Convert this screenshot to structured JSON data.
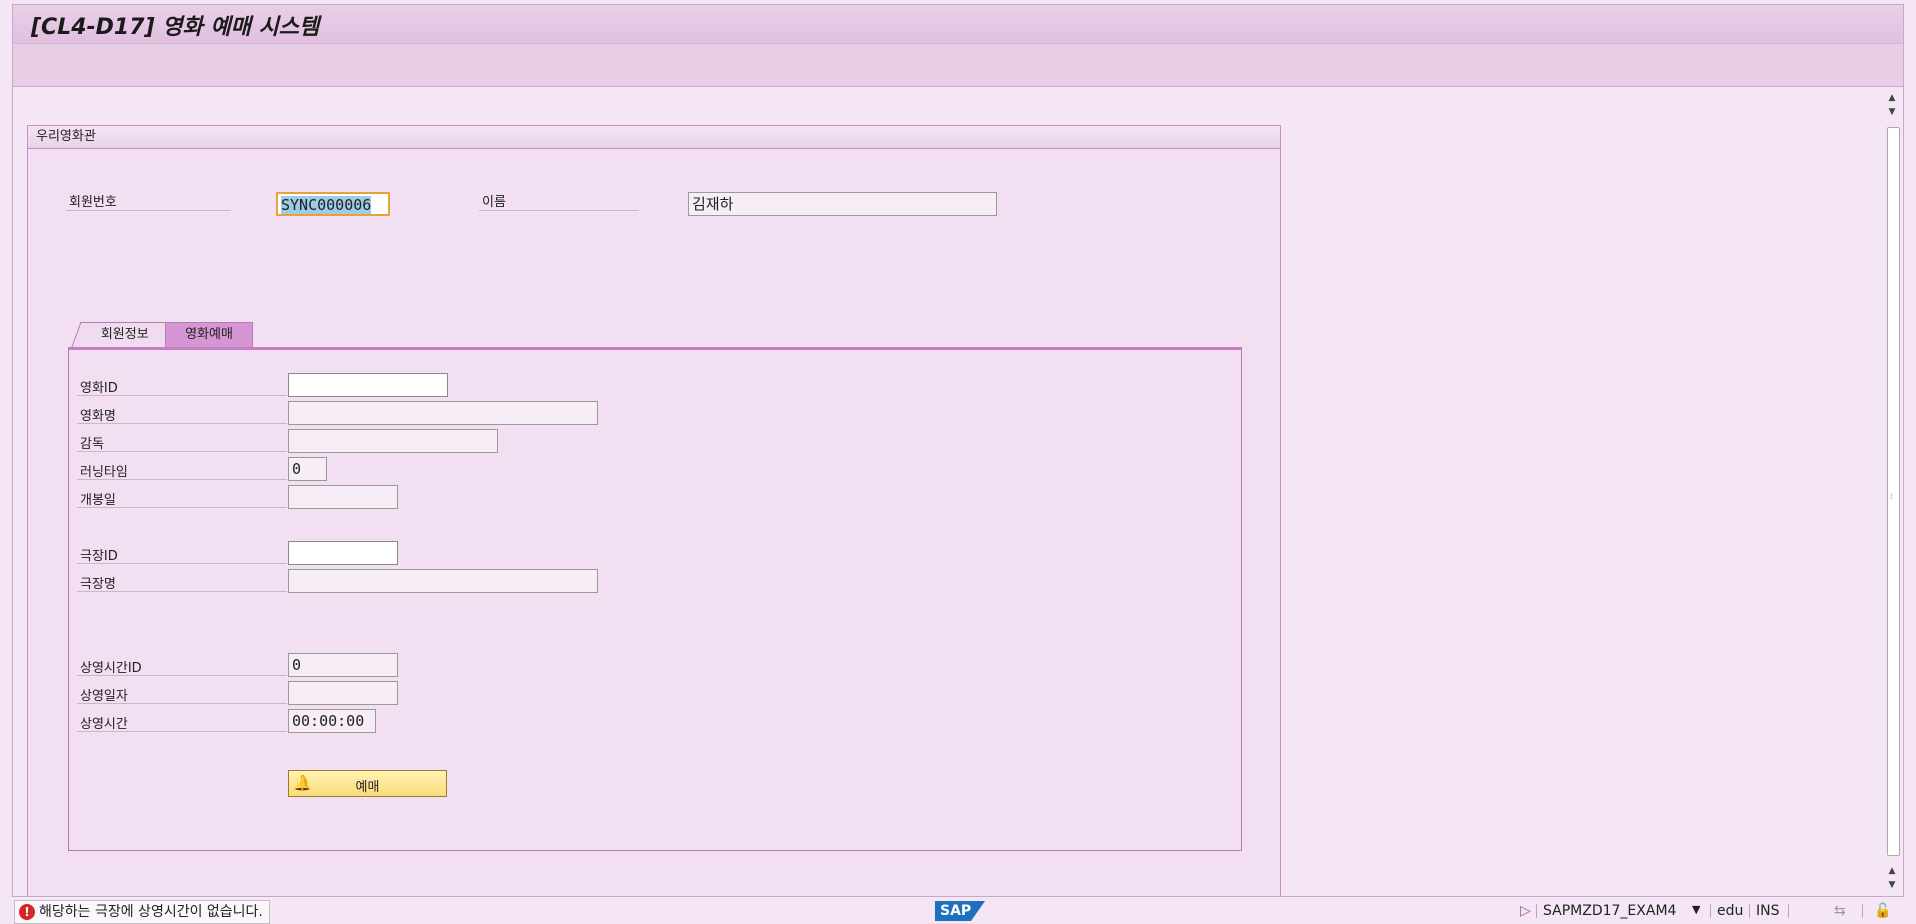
{
  "window": {
    "title": "[CL4-D17] 영화 예매 시스템"
  },
  "group": {
    "title": "우리영화관",
    "member_no_label": "회원번호",
    "member_no_value": "SYNC000006",
    "name_label": "이름",
    "name_value": "김재하"
  },
  "tabs": [
    {
      "label": "회원정보",
      "active": false
    },
    {
      "label": "영화예매",
      "active": true
    }
  ],
  "booking": {
    "movie_id_label": "영화ID",
    "movie_id_value": "",
    "movie_name_label": "영화명",
    "movie_name_value": "",
    "director_label": "감독",
    "director_value": "",
    "running_time_label": "러닝타임",
    "running_time_value": "0",
    "release_date_label": "개봉일",
    "release_date_value": "",
    "theater_id_label": "극장ID",
    "theater_id_value": "",
    "theater_name_label": "극장명",
    "theater_name_value": "",
    "showtime_id_label": "상영시간ID",
    "showtime_id_value": "0",
    "show_date_label": "상영일자",
    "show_date_value": "",
    "show_time_label": "상영시간",
    "show_time_value": "00:00:00",
    "book_button_label": "예매"
  },
  "statusbar": {
    "message": "해당하는 극장에 상영시간이 없습니다.",
    "message_type": "error",
    "sap_logo": "SAP",
    "program": "SAPMZD17_EXAM4",
    "client": "edu",
    "mode": "INS"
  },
  "colors": {
    "background": "#f4e6f4",
    "title_bar": "#e8cde6",
    "active_tab": "#d696d3",
    "button": "#f8dc7a",
    "error": "#d52727",
    "focus_border": "#e7a23a"
  }
}
